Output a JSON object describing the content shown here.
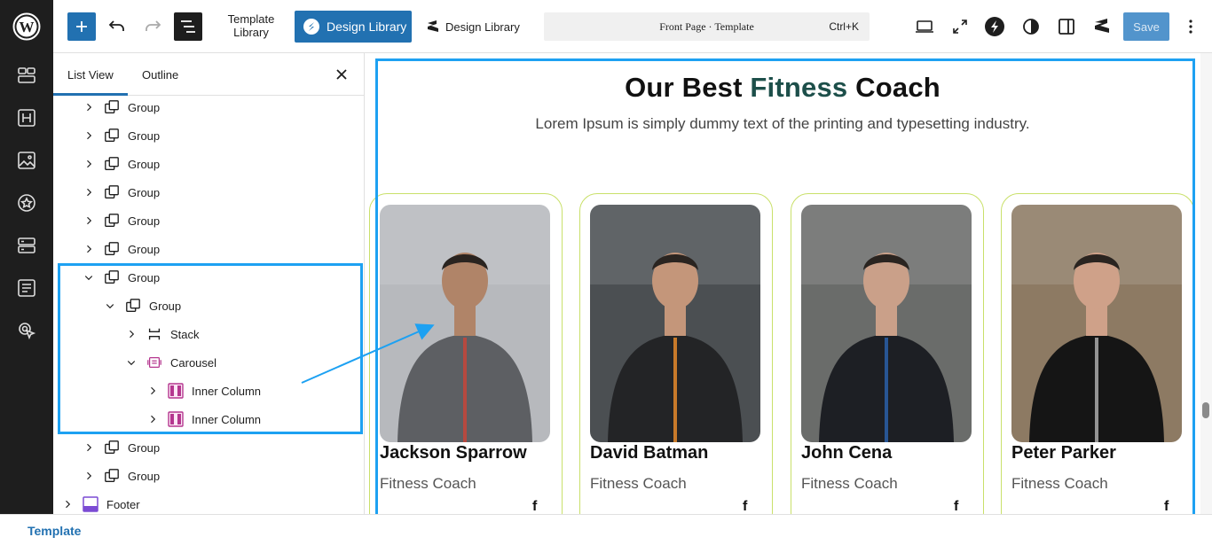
{
  "toolbar": {
    "template_library": "Template\nLibrary",
    "design_library_active": "Design Library",
    "design_library_plain": "Design Library",
    "command_center": "Front Page · Template",
    "shortcut": "Ctrl+K",
    "save_label": "Save"
  },
  "panel": {
    "tab_list_view": "List View",
    "tab_outline": "Outline",
    "rows": [
      {
        "label": "Group",
        "icon": "group-icon",
        "expanded": false
      },
      {
        "label": "Group",
        "icon": "group-icon",
        "expanded": false
      },
      {
        "label": "Group",
        "icon": "group-icon",
        "expanded": false
      },
      {
        "label": "Group",
        "icon": "group-icon",
        "expanded": false
      },
      {
        "label": "Group",
        "icon": "group-icon",
        "expanded": false
      },
      {
        "label": "Group",
        "icon": "group-icon",
        "expanded": false
      },
      {
        "label": "Group",
        "icon": "group-icon",
        "expanded": true
      },
      {
        "label": "Group",
        "icon": "group-icon",
        "expanded": true
      },
      {
        "label": "Stack",
        "icon": "stack-icon",
        "expanded": false
      },
      {
        "label": "Carousel",
        "icon": "carousel-icon",
        "expanded": true
      },
      {
        "label": "Inner Column",
        "icon": "inner-column-icon",
        "expanded": false
      },
      {
        "label": "Inner Column",
        "icon": "inner-column-icon",
        "expanded": false
      },
      {
        "label": "Group",
        "icon": "group-icon",
        "expanded": false
      },
      {
        "label": "Group",
        "icon": "group-icon",
        "expanded": false
      },
      {
        "label": "Footer",
        "icon": "footer-icon",
        "expanded": false
      }
    ]
  },
  "canvas": {
    "heading_pre": "Our Best ",
    "heading_accent": "Fitness",
    "heading_post": " Coach",
    "subheading": "Lorem Ipsum is simply dummy text of the printing and typesetting industry.",
    "accent_color": "#1d4f4a",
    "card_border_color": "#c9e06a",
    "coaches": [
      {
        "name": "Jackson Sparrow",
        "role": "Fitness Coach",
        "social": "f"
      },
      {
        "name": "David Batman",
        "role": "Fitness Coach",
        "social": "f"
      },
      {
        "name": "John Cena",
        "role": "Fitness Coach",
        "social": "f"
      },
      {
        "name": "Peter Parker",
        "role": "Fitness Coach",
        "social": "f"
      }
    ]
  },
  "footer": {
    "breadcrumb": "Template"
  },
  "colors": {
    "wp_blue": "#2271b1",
    "highlight": "#1da1f2"
  }
}
